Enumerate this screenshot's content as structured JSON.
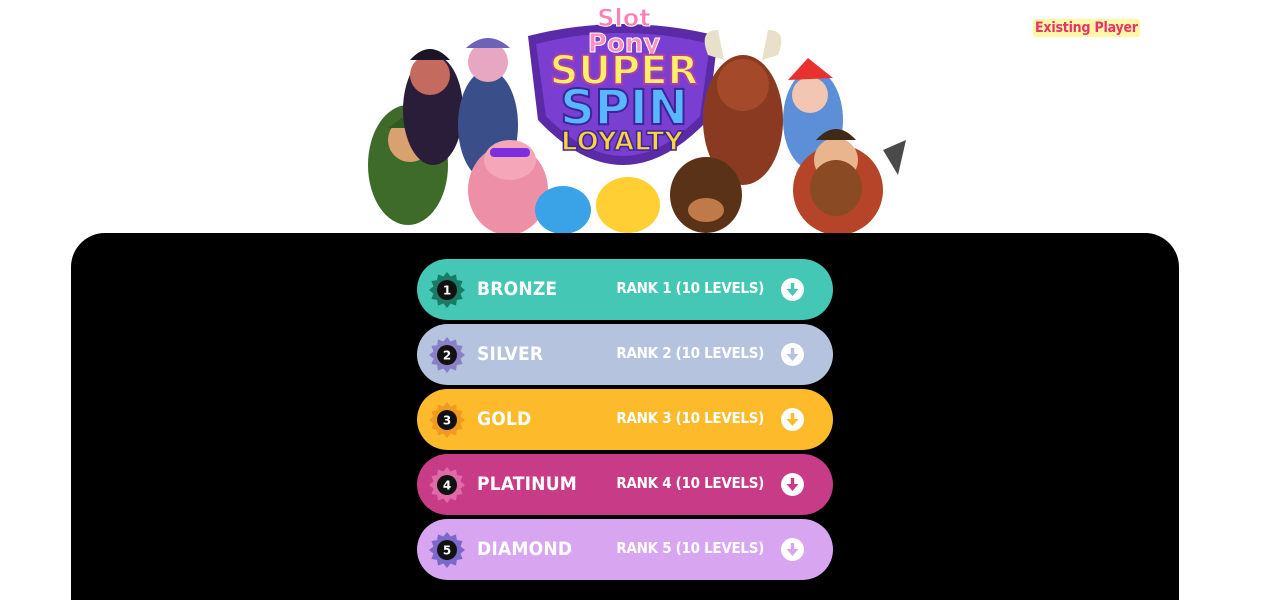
{
  "header": {
    "existing_player_label": "Existing Player"
  },
  "hero": {
    "logo_line1": "Slot",
    "logo_line2": "Pony",
    "logo_line3": "SUPER",
    "logo_line4": "SPIN",
    "logo_line5": "LOYALTY"
  },
  "ranks": [
    {
      "number": "1",
      "name": "BRONZE",
      "levels": "RANK 1 (10 LEVELS)",
      "color": "#44c7b4",
      "arrow_color": "#44c7b4",
      "badge_color": "#1a7a66"
    },
    {
      "number": "2",
      "name": "SILVER",
      "levels": "RANK 2 (10 LEVELS)",
      "color": "#b6c3df",
      "arrow_color": "#b6c3df",
      "badge_color": "#8a80c8"
    },
    {
      "number": "3",
      "name": "GOLD",
      "levels": "RANK 3 (10 LEVELS)",
      "color": "#fdbb2b",
      "arrow_color": "#fdbb2b",
      "badge_color": "#f29a1f"
    },
    {
      "number": "4",
      "name": "PLATINUM",
      "levels": "RANK 4 (10 LEVELS)",
      "color": "#c83b87",
      "arrow_color": "#c83b87",
      "badge_color": "#e06aa8"
    },
    {
      "number": "5",
      "name": "DIAMOND",
      "levels": "RANK 5 (10 LEVELS)",
      "color": "#d8a5f0",
      "arrow_color": "#d8a5f0",
      "badge_color": "#7c68c8"
    }
  ]
}
